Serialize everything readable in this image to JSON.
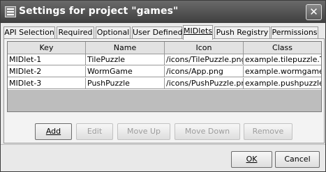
{
  "window": {
    "title": "Settings for project \"games\""
  },
  "tabs": [
    {
      "label": "API Selection"
    },
    {
      "label": "Required"
    },
    {
      "label": "Optional"
    },
    {
      "label": "User Defined"
    },
    {
      "label": "MIDlets",
      "active": true
    },
    {
      "label": "Push Registry"
    },
    {
      "label": "Permissions"
    }
  ],
  "table": {
    "columns": [
      "Key",
      "Name",
      "Icon",
      "Class"
    ],
    "rows": [
      [
        "MIDlet-1",
        "TilePuzzle",
        "/icons/TilePuzzle.png",
        "example.tilepuzzle.Ti..."
      ],
      [
        "MIDlet-2",
        "WormGame",
        "/icons/App.png",
        "example.wormgame...."
      ],
      [
        "MIDlet-3",
        "PushPuzzle",
        "/icons/PushPuzzle.png",
        "example.pushpuzzle...."
      ]
    ]
  },
  "actions": {
    "add": "Add",
    "edit": "Edit",
    "move_up": "Move Up",
    "move_down": "Move Down",
    "remove": "Remove"
  },
  "dialog": {
    "ok": "OK",
    "cancel": "Cancel"
  },
  "icons": {
    "app": "settings-app-icon",
    "close": "close-icon"
  }
}
